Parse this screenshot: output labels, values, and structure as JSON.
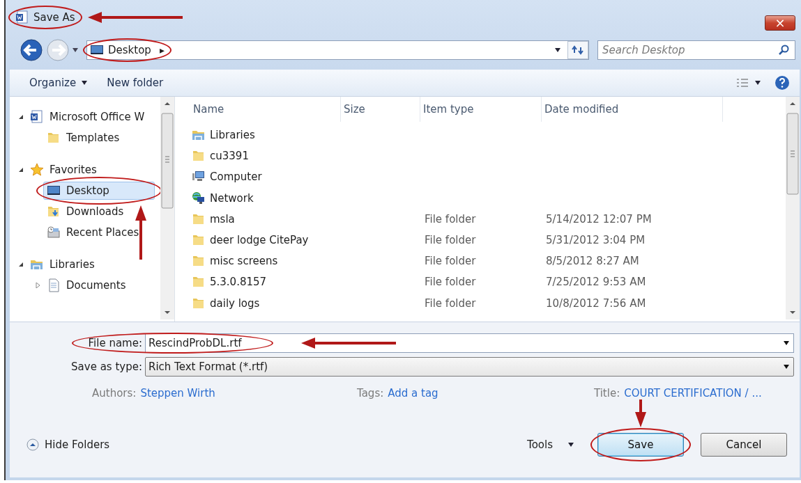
{
  "window": {
    "title": "Save As",
    "circled": true,
    "pointed": true,
    "close": "×"
  },
  "navigation": {
    "address": "Desktop",
    "address_arrow": "▸",
    "circled": true,
    "search": {
      "placeholder": "Search Desktop"
    }
  },
  "toolbar": {
    "organize": "Organize",
    "new_folder": "New folder"
  },
  "sidebar": {
    "items": [
      {
        "label": "Microsoft Office W",
        "kind": "word",
        "expanded": true,
        "children": [
          {
            "label": "Templates",
            "kind": "folder",
            "selected": false
          }
        ]
      },
      {
        "label": "Favorites",
        "kind": "star",
        "expanded": true,
        "children": [
          {
            "label": "Desktop",
            "kind": "desktop",
            "selected": true,
            "circled": true,
            "pointed": true
          },
          {
            "label": "Downloads",
            "kind": "downloads",
            "selected": false
          },
          {
            "label": "Recent Places",
            "kind": "recent",
            "selected": false
          }
        ]
      },
      {
        "label": "Libraries",
        "kind": "library",
        "expanded": true,
        "children": [
          {
            "label": "Documents",
            "kind": "document",
            "selected": false,
            "expanded": false
          }
        ]
      }
    ]
  },
  "table": {
    "columns": [
      "Name",
      "Size",
      "Item type",
      "Date modified"
    ],
    "rows": [
      {
        "kind": "library",
        "name": "Libraries"
      },
      {
        "kind": "folder",
        "name": "cu3391"
      },
      {
        "kind": "computer",
        "name": "Computer"
      },
      {
        "kind": "network",
        "name": "Network"
      },
      {
        "kind": "folder",
        "name": "msla",
        "type": "File folder",
        "date": "5/14/2012 12:07 PM"
      },
      {
        "kind": "folder",
        "name": "deer lodge CitePay",
        "type": "File folder",
        "date": "5/31/2012 3:04 PM"
      },
      {
        "kind": "folder",
        "name": "misc screens",
        "type": "File folder",
        "date": "8/5/2012 8:27 AM"
      },
      {
        "kind": "folder",
        "name": "5.3.0.8157",
        "type": "File folder",
        "date": "7/25/2012 9:53 AM"
      },
      {
        "kind": "folder",
        "name": "daily logs",
        "type": "File folder",
        "date": "10/8/2012 7:56 AM"
      }
    ]
  },
  "form": {
    "file_name": {
      "label": "File name:",
      "value": "RescindProbDL.rtf",
      "circled": true,
      "pointed": true
    },
    "save_as_type": {
      "label": "Save as type:",
      "value": "Rich Text Format (*.rtf)"
    },
    "authors": {
      "label": "Authors:",
      "value": "Steppen Wirth"
    },
    "tags": {
      "label": "Tags:",
      "value": "Add a tag"
    },
    "title": {
      "label": "Title:",
      "value": "COURT CERTIFICATION / ..."
    }
  },
  "footer": {
    "hide_folders": "Hide Folders",
    "tools": "Tools",
    "buttons": [
      {
        "label": "Save",
        "default": true,
        "circled": true,
        "pointed": true
      },
      {
        "label": "Cancel",
        "default": false
      }
    ]
  }
}
